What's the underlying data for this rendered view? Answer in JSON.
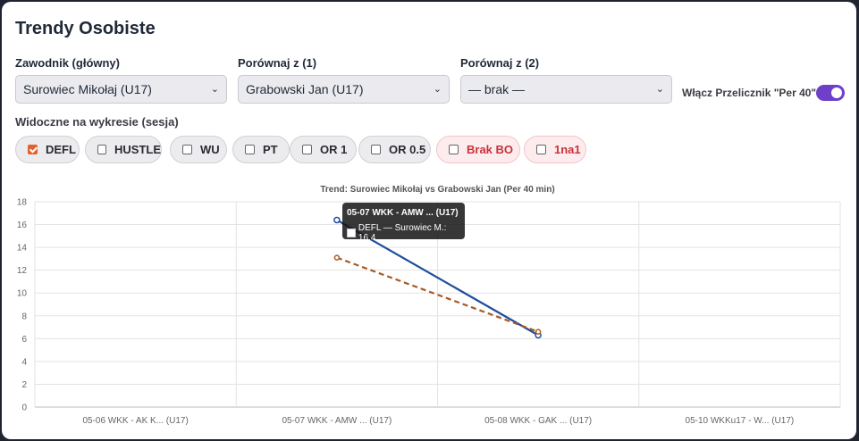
{
  "page": {
    "title": "Trendy Osobiste"
  },
  "filters": {
    "main": {
      "label": "Zawodnik (główny)",
      "value": "Surowiec Mikołaj (U17)"
    },
    "compare1": {
      "label": "Porównaj z (1)",
      "value": "Grabowski Jan (U17)"
    },
    "compare2": {
      "label": "Porównaj z (2)",
      "value": "— brak —"
    },
    "per40": {
      "label": "Włącz Przelicznik \"Per 40\"",
      "enabled": true
    }
  },
  "visible": {
    "label": "Widoczne na wykresie (sesja)",
    "items": [
      {
        "label": "DEFL",
        "checked": true,
        "warn": false
      },
      {
        "label": "HUSTLE",
        "checked": false,
        "warn": false
      },
      {
        "label": "WU",
        "checked": false,
        "warn": false
      },
      {
        "label": "PT",
        "checked": false,
        "warn": false
      },
      {
        "label": "OR 1",
        "checked": false,
        "warn": false
      },
      {
        "label": "OR 0.5",
        "checked": false,
        "warn": false
      },
      {
        "label": "Brak BO",
        "checked": false,
        "warn": true
      },
      {
        "label": "1na1",
        "checked": false,
        "warn": true
      }
    ]
  },
  "colors": {
    "accent": "#6e3fc9",
    "series1": "#1f4e9c",
    "series2": "#a85a24",
    "warn": "#c8323a"
  },
  "chart_data": {
    "type": "line",
    "title": "Trend: Surowiec Mikołaj vs Grabowski Jan (Per 40 min)",
    "categories": [
      "05-06 WKK - AK K... (U17)",
      "05-07 WKK - AMW ... (U17)",
      "05-08 WKK - GAK ... (U17)",
      "05-10 WKKu17 - W... (U17)"
    ],
    "ylim": [
      0,
      18
    ],
    "yticks": [
      0,
      2,
      4,
      6,
      8,
      10,
      12,
      14,
      16,
      18
    ],
    "grid": true,
    "series": [
      {
        "values": [
          null,
          16.4,
          6.3,
          null
        ],
        "style": "solid"
      },
      {
        "values": [
          null,
          13.1,
          6.6,
          null
        ],
        "style": "dashed"
      }
    ]
  },
  "tooltip": {
    "title": "05-07 WKK - AMW ... (U17)",
    "body": "DEFL — Surowiec M.: 16.4"
  }
}
